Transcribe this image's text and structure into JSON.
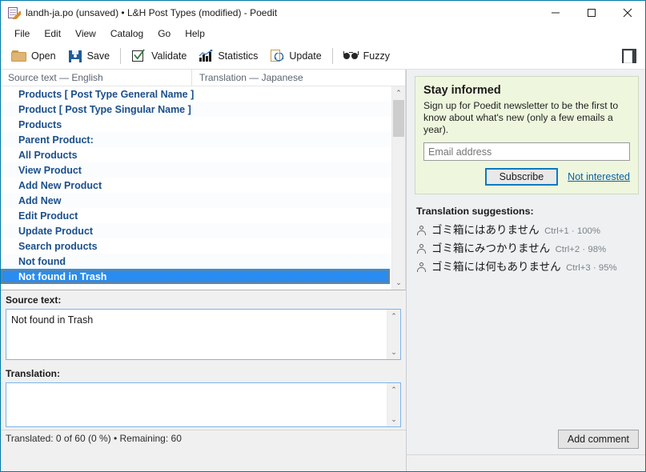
{
  "window": {
    "title": "landh-ja.po (unsaved) • L&H Post Types (modified) - Poedit",
    "app_icon": "poedit-document-pencil-icon",
    "minimize_label": "—",
    "maximize_label": "□",
    "close_label": "✕",
    "accent": "#0078a8"
  },
  "menubar": {
    "items": [
      {
        "label": "File"
      },
      {
        "label": "Edit"
      },
      {
        "label": "View"
      },
      {
        "label": "Catalog"
      },
      {
        "label": "Go"
      },
      {
        "label": "Help"
      }
    ]
  },
  "toolbar": {
    "buttons": [
      {
        "label": "Open",
        "icon": "folder-icon"
      },
      {
        "label": "Save",
        "icon": "floppy-disk-icon"
      },
      {
        "label": "Validate",
        "icon": "checkmark-box-icon"
      },
      {
        "label": "Statistics",
        "icon": "bar-chart-icon"
      },
      {
        "label": "Update",
        "icon": "refresh-page-icon"
      },
      {
        "label": "Fuzzy",
        "icon": "glasses-icon"
      }
    ],
    "sidebar_toggle_icon": "sidebar-panel-icon"
  },
  "list": {
    "columns": [
      {
        "label": "Source text — English"
      },
      {
        "label": "Translation — Japanese"
      }
    ],
    "rows": [
      {
        "source": "Products  [ Post Type General Name ]",
        "translation": "",
        "selected": false
      },
      {
        "source": "Product  [ Post Type Singular Name ]",
        "translation": "",
        "selected": false
      },
      {
        "source": "Products",
        "translation": "",
        "selected": false
      },
      {
        "source": "Parent Product:",
        "translation": "",
        "selected": false
      },
      {
        "source": "All Products",
        "translation": "",
        "selected": false
      },
      {
        "source": "View Product",
        "translation": "",
        "selected": false
      },
      {
        "source": "Add New Product",
        "translation": "",
        "selected": false
      },
      {
        "source": "Add New",
        "translation": "",
        "selected": false
      },
      {
        "source": "Edit Product",
        "translation": "",
        "selected": false
      },
      {
        "source": "Update Product",
        "translation": "",
        "selected": false
      },
      {
        "source": "Search products",
        "translation": "",
        "selected": false
      },
      {
        "source": "Not found",
        "translation": "",
        "selected": false
      },
      {
        "source": "Not found in Trash",
        "translation": "",
        "selected": true
      }
    ],
    "selected_row_color": "#2a8cf0",
    "row_text_color": "#1b4f8a",
    "scrollbar": {
      "up_arrow": "⌃",
      "down_arrow": "⌄",
      "thumb_top_percent": 0,
      "thumb_height_percent": 19
    }
  },
  "source_pane": {
    "label": "Source text:",
    "value": "Not found in Trash",
    "scroll_up": "⌃",
    "scroll_down": "⌄"
  },
  "translation_pane": {
    "label": "Translation:",
    "value": "",
    "scroll_up": "⌃",
    "scroll_down": "⌄"
  },
  "statusbar": {
    "text": "Translated: 0 of 60 (0 %)  •  Remaining: 60"
  },
  "newsletter": {
    "title": "Stay informed",
    "body": "Sign up for Poedit newsletter to be the first to know about what's new (only a few emails a year).",
    "email_placeholder": "Email address",
    "email_value": "",
    "subscribe_label": "Subscribe",
    "not_interested_label": "Not interested",
    "background": "#eef7dd",
    "focus_border": "#0b7bc1"
  },
  "suggestions": {
    "title": "Translation suggestions:",
    "items": [
      {
        "text": "ゴミ箱にはありません",
        "meta": "Ctrl+1 · 100%",
        "icon": "person-icon"
      },
      {
        "text": "ゴミ箱にみつかりません",
        "meta": "Ctrl+2 · 98%",
        "icon": "person-icon"
      },
      {
        "text": "ゴミ箱には何もありません",
        "meta": "Ctrl+3 · 95%",
        "icon": "person-icon"
      }
    ]
  },
  "comment": {
    "add_label": "Add comment"
  }
}
